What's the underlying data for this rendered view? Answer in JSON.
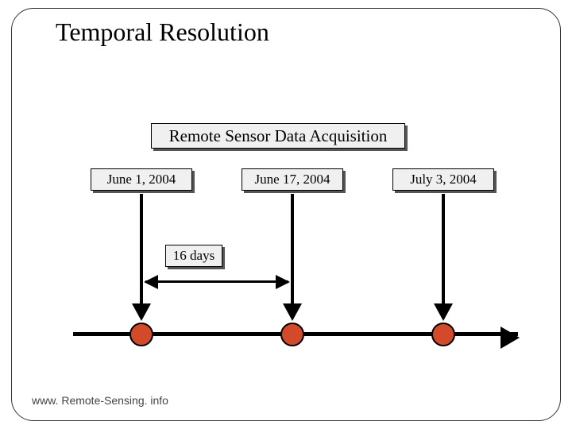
{
  "title": "Temporal Resolution",
  "header_box": "Remote Sensor Data Acquisition",
  "dates": {
    "d1": "June 1, 2004",
    "d2": "June 17, 2004",
    "d3": "July 3, 2004"
  },
  "interval_label": "16 days",
  "footer": "www. Remote-Sensing. info",
  "colors": {
    "dot_fill": "#d24a2a",
    "box_fill": "#f0f0f0"
  }
}
